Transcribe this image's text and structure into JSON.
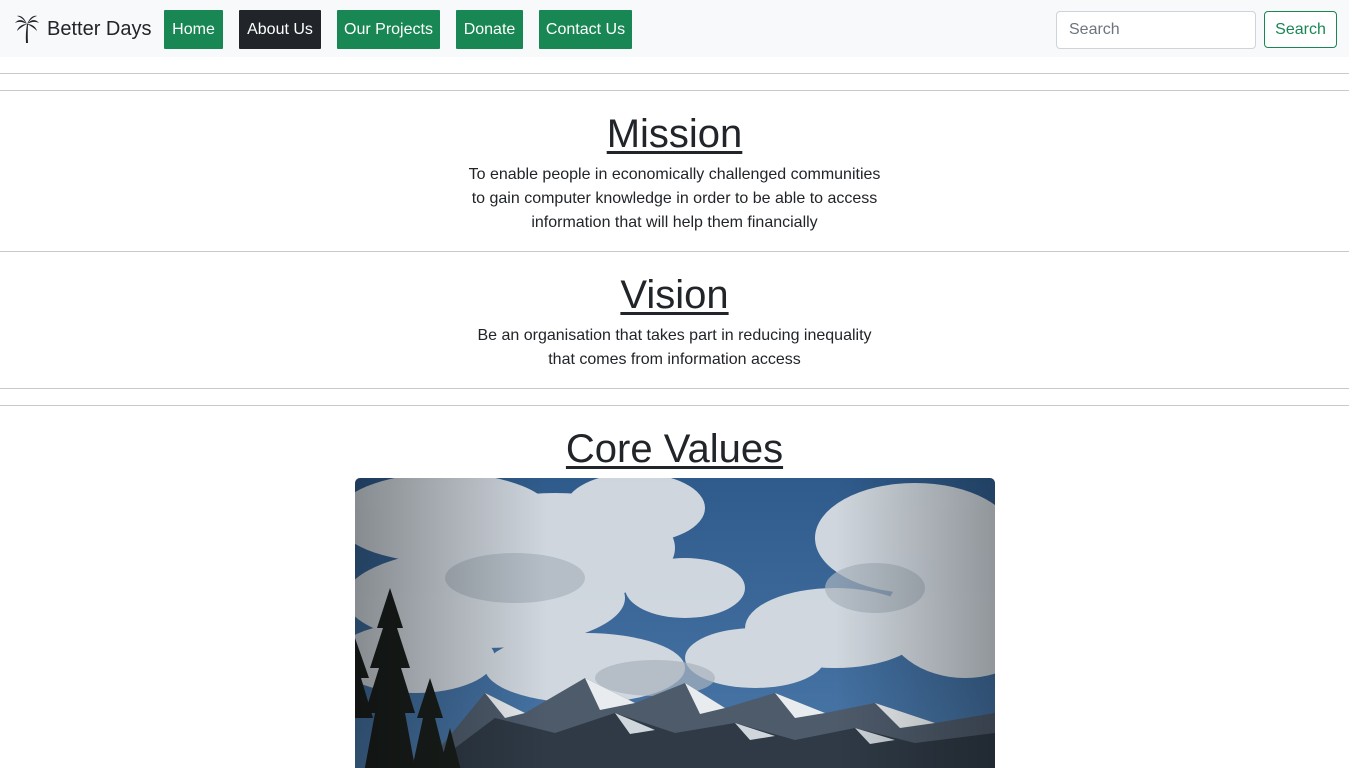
{
  "navbar": {
    "brand": "Better Days",
    "items": [
      {
        "label": "Home",
        "active": false
      },
      {
        "label": "About Us",
        "active": true
      },
      {
        "label": "Our Projects",
        "active": false
      },
      {
        "label": "Donate",
        "active": false
      },
      {
        "label": "Contact Us",
        "active": false
      }
    ],
    "search": {
      "placeholder": "Search",
      "value": "",
      "button_label": "Search"
    }
  },
  "mission": {
    "heading": "Mission",
    "lines": [
      "To enable people in economically challenged communities",
      "to gain computer knowledge in order to be able to access",
      "information that will help them financially"
    ]
  },
  "vision": {
    "heading": "Vision",
    "lines": [
      "Be an organisation that takes part in reducing inequality",
      "that comes from information access"
    ]
  },
  "core_values": {
    "heading": "Core Values"
  },
  "colors": {
    "nav_button": "#198754",
    "nav_active": "#212529",
    "navbar_bg": "#f8f9fa"
  },
  "icons": {
    "brand": "palm-tree-icon",
    "scroll_up": "triangle-up-icon",
    "scroll_down": "triangle-down-icon"
  }
}
